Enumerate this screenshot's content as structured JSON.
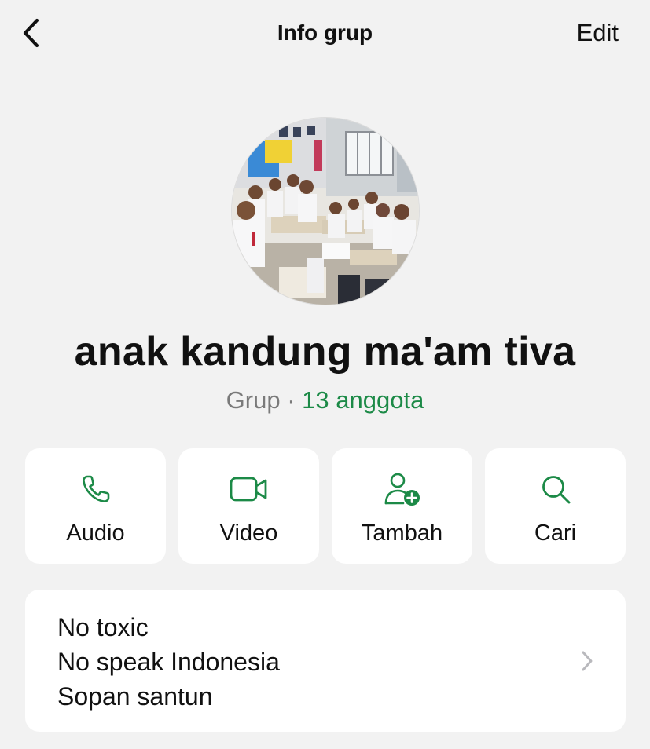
{
  "header": {
    "title": "Info grup",
    "edit_label": "Edit",
    "back_icon": "chevron-left-icon"
  },
  "group": {
    "name": "anak kandung ma'am tiva",
    "type_label": "Grup",
    "separator": " · ",
    "members_label": "13 anggota"
  },
  "actions": [
    {
      "label": "Audio",
      "icon": "phone-icon"
    },
    {
      "label": "Video",
      "icon": "video-camera-icon"
    },
    {
      "label": "Tambah",
      "icon": "add-person-icon"
    },
    {
      "label": "Cari",
      "icon": "search-icon"
    }
  ],
  "description": {
    "lines": [
      "No toxic",
      "No speak Indonesia",
      "Sopan santun"
    ],
    "chevron_icon": "chevron-right-icon"
  },
  "colors": {
    "accent_green": "#1c8a47",
    "background": "#f2f2f2",
    "card": "#ffffff",
    "muted_text": "#7a7a7a"
  }
}
